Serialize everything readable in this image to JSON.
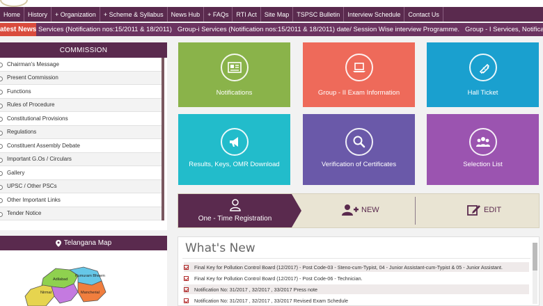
{
  "nav": {
    "items": [
      "Home",
      "History",
      "+ Organization",
      "+ Scheme & Syllabus",
      "News Hub",
      "+ FAQs",
      "RTI Act",
      "Site Map",
      "TSPSC Bulletin",
      "Interview Schedule",
      "Contact Us"
    ]
  },
  "ticker": {
    "label": "atest News",
    "items": [
      "Services (Notification nos:15/2011 & 18/2011)",
      "Group-i Services (Notification nos:15/2011 & 18/2011) date/ Session Wise interview Programme.",
      "Group - I Services, Notification Nos."
    ]
  },
  "sidebar": {
    "title": "COMMISSION",
    "items": [
      "Chairman's Message",
      "Present Commission",
      "Functions",
      "Rules of Procedure",
      "Constitutional Provisions",
      "Regulations",
      "Constituent Assembly Debate",
      "Important G.Os / Circulars",
      "Gallery",
      "UPSC / Other PSCs",
      "Other Important Links",
      "Tender Notice"
    ],
    "map_title": "Telangana Map",
    "map_labels": [
      "Adilabad",
      "Kumuram Bheem",
      "Nirmal",
      "Mancherial"
    ]
  },
  "tiles": [
    {
      "label": "Notifications",
      "color": "#8ab34a",
      "icon": "newspaper-icon"
    },
    {
      "label": "Group - II Exam Information",
      "color": "#ee6a5a",
      "icon": "laptop-icon"
    },
    {
      "label": "Hall Ticket",
      "color": "#1aa0cf",
      "icon": "ticket-icon"
    },
    {
      "label": "Results, Keys, OMR Download",
      "color": "#22bccb",
      "icon": "megaphone-icon"
    },
    {
      "label": "Verification of Certificates",
      "color": "#6a59a9",
      "icon": "magnifier-icon"
    },
    {
      "label": "Selection List",
      "color": "#9b54b0",
      "icon": "users-icon"
    }
  ],
  "registration": {
    "title": "One - Time Registration",
    "new_label": "NEW",
    "edit_label": "EDIT"
  },
  "whats_new": {
    "title": "What's New",
    "items": [
      "Final Key for Pollution Control Board (12/2017) - Post Code-03 - Steno-cum-Typist, 04 - Junior Assistant-cum-Typist & 05 - Junior Assistant.",
      "Final Key for Pollution Control Board (12/2017) - Post Code-06 - Technician.",
      "Notification No: 31/2017 , 32/2017 , 33/2017 Press note",
      "Notification No: 31/2017 , 32/2017 , 33/2017 Revised Exam Schedule"
    ]
  }
}
